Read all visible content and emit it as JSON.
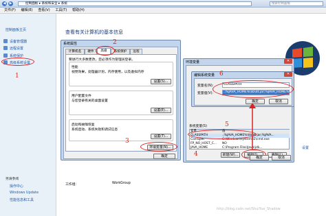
{
  "address": {
    "crumb": "控制面板 ▸ 系统和安全 ▸ 系统",
    "search": "搜索控制面板"
  },
  "menu": [
    "文件(F)",
    "编辑(E)",
    "查看(V)",
    "工具(T)",
    "帮助(H)"
  ],
  "sidebar": {
    "home": "控制面板主页",
    "items": [
      "设备管理器",
      "远程设置",
      "系统保护",
      "高级系统设置"
    ],
    "see_also_title": "另请参阅",
    "see_also": [
      "操作中心",
      "Windows Update",
      "性能信息和工具"
    ]
  },
  "main": {
    "title": "查看有关计算机的基本信息",
    "workgroup_label": "工作组:",
    "workgroup": "WorkGroup",
    "setting_link": "设置"
  },
  "sysprops": {
    "title": "系统属性",
    "tabs": [
      "计算机名",
      "硬件",
      "高级",
      "系统保护",
      "远程"
    ],
    "admin_note": "要进行大多数更改，您必须作为管理员登录。",
    "perf_label": "性能",
    "perf_desc": "视觉效果，处理器计划，内存使用，以及虚拟内存",
    "profile_label": "用户配置文件",
    "profile_desc": "与您登录有关的桌面设置",
    "startup_label": "启动和故障恢复",
    "startup_desc": "系统启动、系统失败和调试信息",
    "settings_btn": "设置(S)...",
    "settings_btn2": "设置(E)...",
    "settings_btn3": "设置(T)...",
    "env_btn": "环境变量(N)...",
    "ok": "确定"
  },
  "envvars": {
    "title": "环境变量",
    "sysvar_label": "系统变量(S)",
    "col_var": "变量",
    "col_val": "值",
    "rows": [
      [
        "CLASSPATH",
        ".;%JAVA_HOME%\\lib\\dt.jar;%JAVA..."
      ],
      [
        "ComSpec",
        "C:\\Windows\\system32\\cmd.exe"
      ],
      [
        "FP_NO_HOST_C...",
        "NO"
      ],
      [
        "JAVA_HOME",
        "C:\\Program Files\\Java\\jdk..."
      ]
    ],
    "new": "新建(W)...",
    "edit": "编辑(I)...",
    "delete": "删除(L)",
    "ok": "确定",
    "cancel": "取消"
  },
  "editvar": {
    "title": "编辑系统变量",
    "name_label": "变量名(N):",
    "value_label": "变量值(V):",
    "name": "CLASSPATH",
    "value": ".;%JAVA_HOME%\\lib\\dt.jar;%JAVA_HOME%\\lib\\tools.jar;",
    "ok": "确定",
    "cancel": "取消"
  },
  "annotations": [
    "1",
    "2",
    "3",
    "4",
    "5",
    "6"
  ],
  "watermark": "http://blog.csdn.net/ShuiYue_Shadow"
}
